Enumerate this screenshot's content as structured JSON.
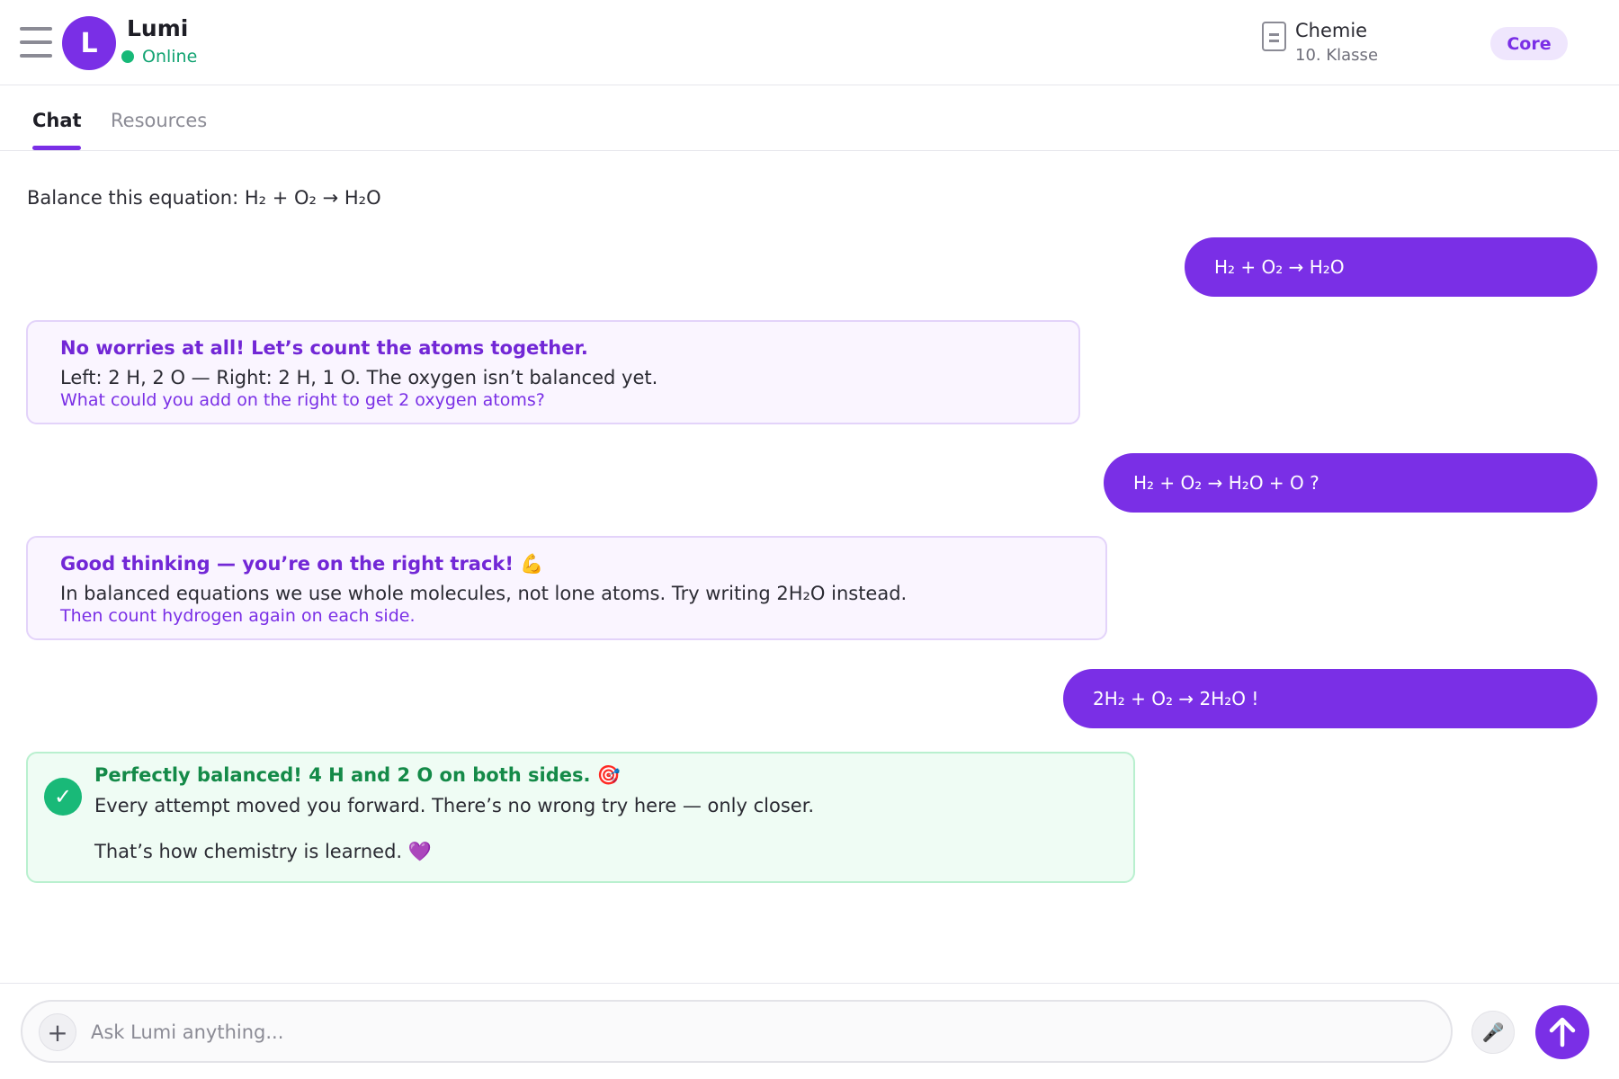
{
  "header": {
    "bot_name": "Lumi",
    "avatar_letter": "L",
    "status": "Online",
    "subject": "Chemie",
    "grade": "10. Klasse",
    "plan_badge": "Core"
  },
  "tabs": [
    {
      "label": "Chat",
      "active": true
    },
    {
      "label": "Resources",
      "active": false
    }
  ],
  "conversation": {
    "prompt": "Balance this equation: H₂ + O₂ → H₂O",
    "user_messages": [
      "H₂ + O₂ → H₂O",
      "H₂ + O₂ → H₂O + O ?",
      "2H₂ + O₂ → 2H₂O !"
    ],
    "bot_messages": [
      {
        "title": "No worries at all! Let’s count the atoms together.",
        "body": "Left: 2 H, 2 O — Right: 2 H, 1 O. The oxygen isn’t balanced yet.",
        "hint": "What could you add on the right to get 2 oxygen atoms?"
      },
      {
        "title": "Good thinking — you’re on the right track! 💪",
        "body": "In balanced equations we use whole molecules, not lone atoms. Try writing 2H₂O instead.",
        "hint": "Then count hydrogen again on each side."
      }
    ],
    "success": {
      "icon": "✓",
      "title": "Perfectly balanced! 4 H and 2 O on both sides. 🎯",
      "body": "Every attempt moved you forward. There’s no wrong try here — only closer.",
      "outro": "That’s how chemistry is learned. 💜"
    }
  },
  "composer": {
    "placeholder": "Ask Lumi anything...",
    "plus_icon": "+",
    "mic_icon": "🎤"
  },
  "colors": {
    "accent": "#7a2fe6",
    "online": "#17b978",
    "success": "#148a48"
  }
}
